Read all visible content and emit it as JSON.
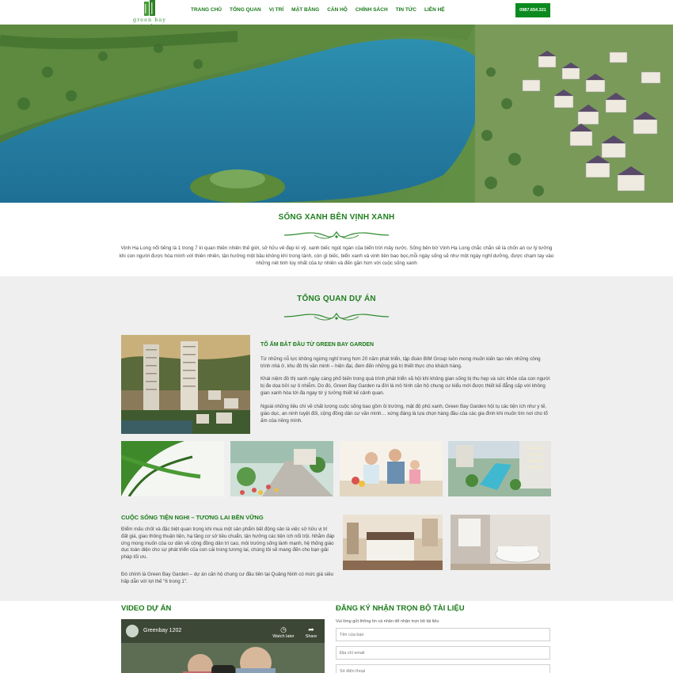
{
  "header": {
    "logo_text": "green bay garden",
    "nav": [
      "TRANG CHỦ",
      "TỔNG QUAN",
      "VỊ TRÍ",
      "MẶT BẰNG",
      "CĂN HỘ",
      "CHÍNH SÁCH",
      "TIN TỨC",
      "LIÊN HỆ"
    ],
    "hotline": "0987.654.321"
  },
  "intro": {
    "title": "SỐNG XANH BÊN VỊNH XANH",
    "text": "Vịnh Hạ Long nổi tiếng là 1 trong 7 kì quan thiên nhiên thế giới, sở hữu vẻ đẹp kì vỹ, xanh biếc ngút ngàn của biển trời mây nước. Sống bên bờ Vịnh Hạ Long chắc chắn sẽ là chốn an cư lý tưởng khi con người được hòa mình với thiên nhiên, tận hưởng một bầu không khí trong lành, còn gì biếc, biển xanh và vịnh tiên bao bọc,mỗi ngày sống sẽ như một ngày nghỉ dưỡng, được chạm tay vào những nét tinh túy nhất của tự nhiên và đến gần hơn với cuộc sống xanh"
  },
  "overview": {
    "title": "TỔNG QUAN DỰ ÁN",
    "subtitle": "TỔ ẤM BẮT ĐẦU TỪ GREEN BAY GARDEN",
    "paragraphs": [
      "Từ những nỗ lực không ngừng nghỉ trong hơn 20 năm phát triển, tập đoàn BIM Group luôn mong muốn kiến tạo nên những công trình nhà ở, khu đô thị văn minh – hiện đại, đem đến những giá trị thiết thực cho khách hàng.",
      "Khái niệm đô thị xanh ngày càng phổ biến trong quá trình phát triển xã hội khi không gian sống bị thu hẹp và sức khỏe của con người bị đe dọa bởi sự ô nhiễm. Do đó, Green Bay Garden ra đời là mô hình căn hộ chung cư kiểu mới được thiết kế đẳng cấp với không gian xanh hòa tới đa ngay từ ý tưởng thiết kế cảnh quan.",
      "Ngoài những tiêu chí về chất lượng cuộc sống bao gồm ôi trường, mật độ phủ xanh, Green Bay Garden hội tụ các tiện ích như y tế, giáo dục, an ninh tuyệt đối, cộng đồng dân cư văn minh… xứng đáng là lựa chọn hàng đầu của các gia đình khi muốn tìm nơi cho tổ ấm của riêng mình."
    ],
    "life_title": "CUỘC SỐNG TIỆN NGHI – TƯƠNG LAI BỀN VỮNG",
    "life_paragraphs": [
      "Điểm mấu chốt và đặc biệt quan trọng khi mua một sản phẩm bất động sản là việc sở hữu vị trí đất giá, giao thông thuận tiện, hạ tầng cơ sở tiêu chuẩn, tận hưởng các tiện ích nổi trội. Nhằm đáp ứng mong muốn của cư dân về cộng đồng dân trí cao, môi trường sống lành mạnh, hệ thống giáo dục toàn diện cho sự phát triển của con cái trong tương lai, chúng tôi sẽ mang đến cho bạn giải pháp tối ưu.",
      "Đó chính là Green Bay Garden – dự án căn hộ chung cư đầu tiên tại Quảng Ninh có mức giá siêu hấp dẫn với lợi thế \"6 trong 1\"."
    ]
  },
  "video": {
    "title": "VIDEO DỰ ÁN",
    "channel": "Greenbay 1202",
    "watch_later": "Watch later",
    "share": "Share"
  },
  "register": {
    "title": "ĐĂNG KÝ NHẬN TRỌN BỘ TÀI LIỆU",
    "note": "Vui lòng gửi thông tin cá nhân để nhận trọn bộ tài liệu",
    "name_placeholder": "Tên của bạn",
    "email_placeholder": "Địa chỉ email",
    "phone_placeholder": "Số điện thoại"
  },
  "colors": {
    "brand_green": "#1a7a1a",
    "hotline_bg": "#0b8a1f",
    "section_bg": "#efefef"
  }
}
